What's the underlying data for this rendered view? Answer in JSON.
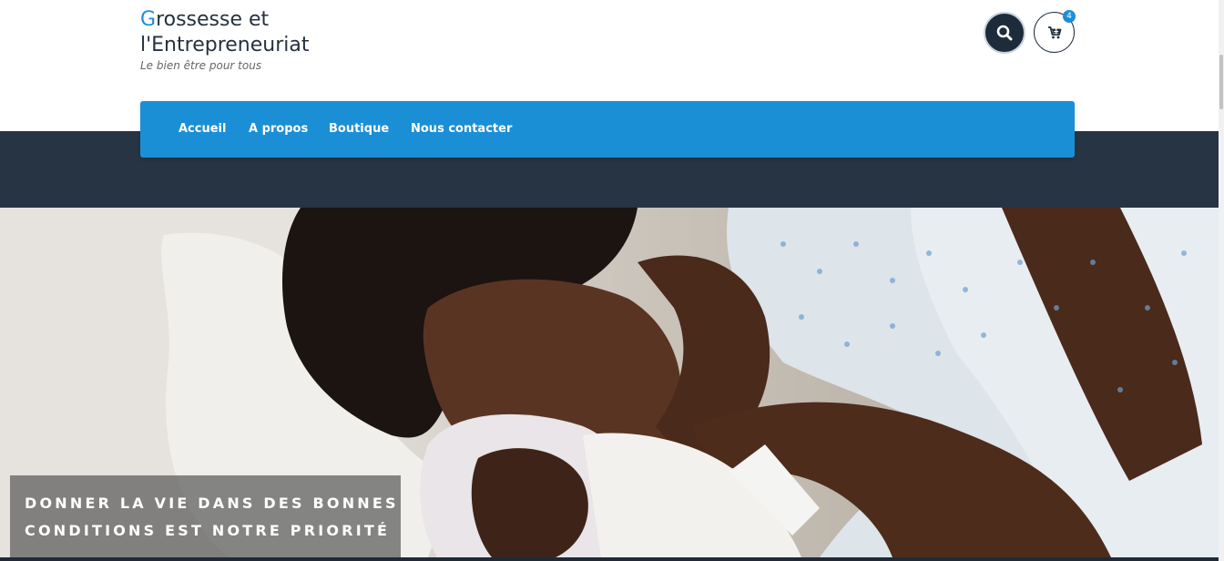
{
  "site": {
    "title_first": "G",
    "title_rest": "rossesse et l'Entrepreneuriat",
    "tagline": "Le bien être pour tous",
    "accent": "#1a8fd6",
    "dark": "#273444"
  },
  "header": {
    "search_icon": "search-icon",
    "cart_icon": "cart-icon",
    "cart_count": "4"
  },
  "nav": {
    "items": [
      {
        "label": "Accueil"
      },
      {
        "label": "A propos"
      },
      {
        "label": "Boutique"
      },
      {
        "label": "Nous contacter"
      }
    ]
  },
  "hero": {
    "caption_line1": "DONNER LA VIE DANS DES BONNES",
    "caption_line2": "CONDITIONS EST NOTRE PRIORITÉ"
  }
}
